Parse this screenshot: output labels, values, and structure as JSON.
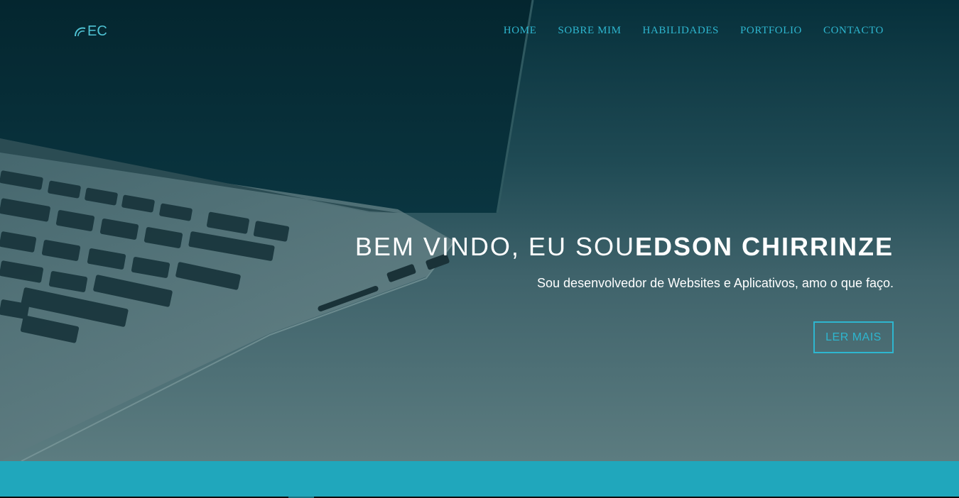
{
  "logo": {
    "text": "EC",
    "icon": "arc-logo-icon"
  },
  "nav": {
    "items": [
      {
        "label": "HOME"
      },
      {
        "label": "SOBRE MIM"
      },
      {
        "label": "HABILIDADES"
      },
      {
        "label": "PORTFOLIO"
      },
      {
        "label": "CONTACTO"
      }
    ]
  },
  "hero": {
    "greeting": "BEM VINDO, EU SOU",
    "name": "EDSON CHIRRINZE",
    "subtitle": "Sou desenvolvedor de Websites e Aplicativos, amo o que faço.",
    "cta_label": "LER MAIS"
  },
  "colors": {
    "accent": "#2eb6cf",
    "band": "#20a7bc",
    "overlay_top": "#06303b",
    "overlay_bottom": "#5c7c80"
  }
}
